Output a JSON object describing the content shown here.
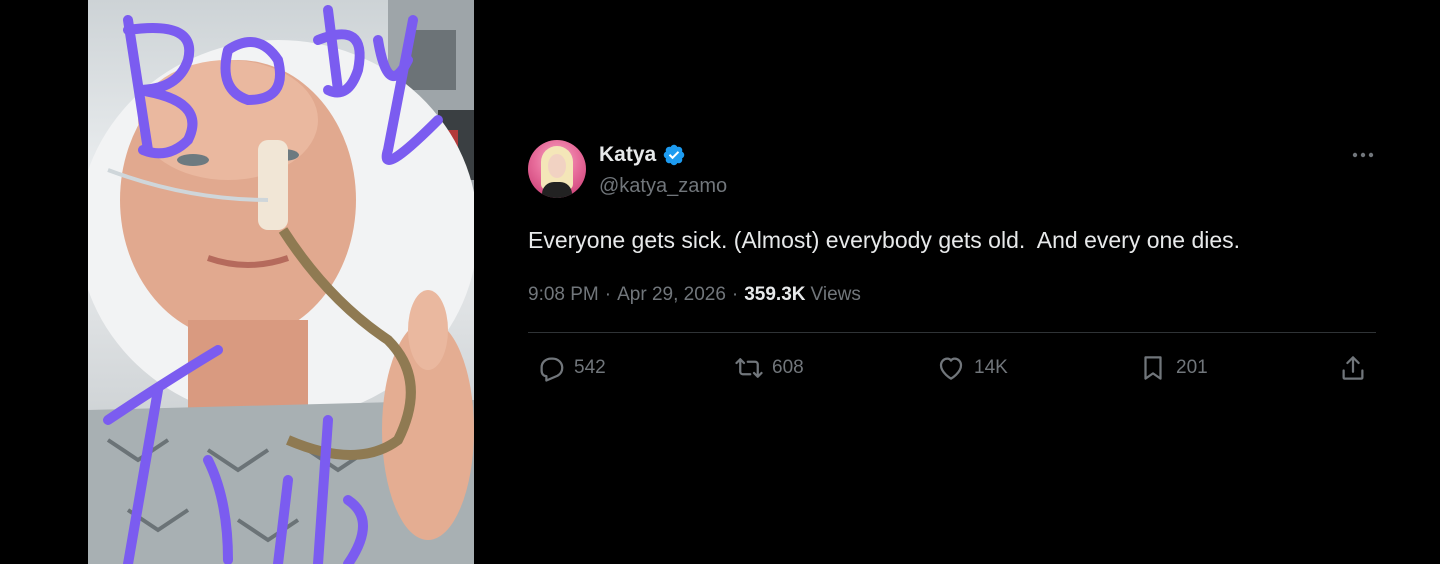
{
  "photo": {
    "icon": "selfie-photo",
    "scribble_text": "Body Talk",
    "scribble_color": "#7b5cf0"
  },
  "tweet": {
    "author": {
      "name": "Katya",
      "handle": "@katya_zamo",
      "verified": true,
      "verified_color": "#1d9bf0"
    },
    "text": "Everyone gets sick. (Almost) everybody gets old.  And every one dies.",
    "time": "9:08 PM",
    "date": "Apr 29, 2026",
    "separator": "·",
    "views_count": "359.3K",
    "views_label": "Views",
    "stats": {
      "replies": "542",
      "reposts": "608",
      "likes": "14K",
      "bookmarks": "201"
    }
  },
  "colors": {
    "background": "#000000",
    "primary_text": "#e7e9ea",
    "secondary_text": "#71767b",
    "divider": "#2f3336"
  }
}
